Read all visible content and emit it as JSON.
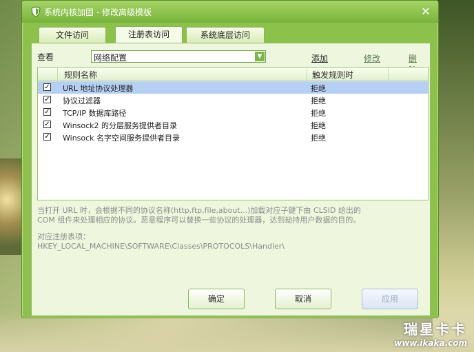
{
  "window": {
    "title": "系统内核加固 - 修改高级模板"
  },
  "tabs": [
    {
      "label": "文件访问"
    },
    {
      "label": "注册表访问"
    },
    {
      "label": "系统底层访问"
    }
  ],
  "view": {
    "label": "查看",
    "selected": "网络配置"
  },
  "actions": {
    "add": "添加",
    "edit": "修改",
    "delete": "删除"
  },
  "table": {
    "headers": [
      "规则名称",
      "触发规则时"
    ],
    "rows": [
      {
        "checked": true,
        "name": "URL 地址协议处理器",
        "action": "拒绝"
      },
      {
        "checked": true,
        "name": "协议过滤器",
        "action": "拒绝"
      },
      {
        "checked": true,
        "name": "TCP/IP 数据库路径",
        "action": "拒绝"
      },
      {
        "checked": true,
        "name": "Winsock2 的分层服务提供者目录",
        "action": "拒绝"
      },
      {
        "checked": true,
        "name": "Winsock 名字空间服务提供者目录",
        "action": "拒绝"
      }
    ]
  },
  "description": {
    "line1": "当打开 URL 时，会根据不同的协议名称(http,ftp,file,about...)加载对应子键下由 CLSID 给出的",
    "line2": "COM 组件来处理相应的协议。恶意程序可以替换一些协议的处理器，达到劫持用户数据的目的。",
    "reg_label": "对应注册表项：",
    "reg_path": "HKEY_LOCAL_MACHINE\\SOFTWARE\\Classes\\PROTOCOLS\\Handler\\"
  },
  "buttons": {
    "ok": "确定",
    "cancel": "取消",
    "apply": "应用"
  },
  "watermark": {
    "brand": "瑞星卡卡",
    "url": "www.ikaka.com"
  },
  "colors": {
    "dialog_green": "#8cc24c",
    "selection_blue": "#b5d0f3",
    "description_gray": "#8b8b8b"
  }
}
